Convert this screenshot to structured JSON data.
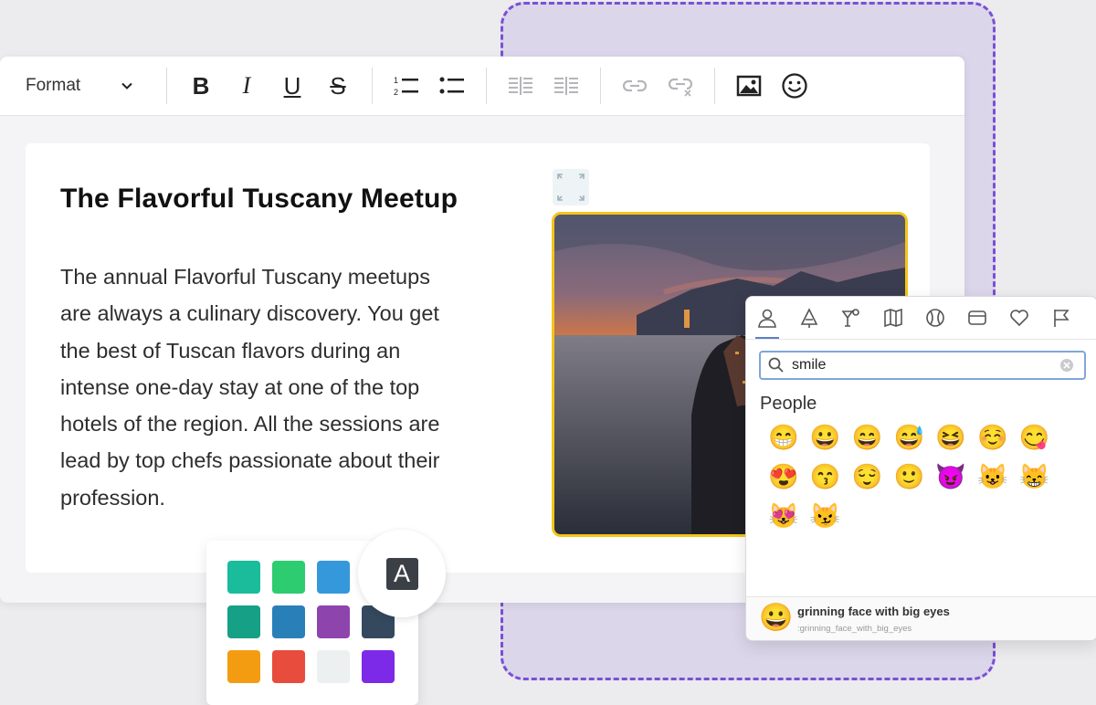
{
  "colors": {
    "accent_purple": "#7a4fd6",
    "image_border": "#f5c518",
    "search_border": "#7fa6d8"
  },
  "toolbar": {
    "format_label": "Format",
    "bold_label": "B",
    "italic_label": "I",
    "underline_label": "U",
    "strike_label": "S",
    "icons": [
      "chevron-down-icon",
      "numbered-list-icon",
      "bullet-list-icon",
      "align-left-icon",
      "align-right-icon",
      "link-icon",
      "unlink-icon",
      "image-icon",
      "smiley-icon"
    ]
  },
  "document": {
    "title": "The Flavorful Tuscany Meetup",
    "lines": [
      "The annual Flavorful Tuscany meetups",
      "are always a culinary discovery. You get",
      "the best of Tuscan flavors during an",
      "intense one-day stay at one of the top",
      "hotels of the region. All the sessions are",
      "lead by top chefs passionate about their",
      "profession."
    ]
  },
  "emoji_picker": {
    "tabs": [
      "people-tab-icon",
      "nature-tab-icon",
      "food-tab-icon",
      "travel-tab-icon",
      "activity-tab-icon",
      "objects-tab-icon",
      "symbols-tab-icon",
      "flags-tab-icon"
    ],
    "search_value": "smile",
    "category_label": "People",
    "emojis": [
      "😁",
      "😀",
      "😄",
      "😅",
      "😆",
      "☺️",
      "😋",
      "😍",
      "😙",
      "😌",
      "🙂",
      "😈",
      "😺",
      "😸",
      "😻",
      "😼"
    ],
    "footer_emoji": "😀",
    "footer_name": "grinning face with big eyes",
    "footer_code": ":grinning_face_with_big_eyes"
  },
  "color_picker": {
    "font_color_label": "A",
    "swatches": [
      "#1abc9c",
      "#2ecc71",
      "#3498db",
      "#16a085",
      "#2980b9",
      "#8e44ad",
      "#34495e",
      "#f39c12",
      "#e74c3c",
      "#ecf0f1",
      "#7d2ae8"
    ]
  }
}
